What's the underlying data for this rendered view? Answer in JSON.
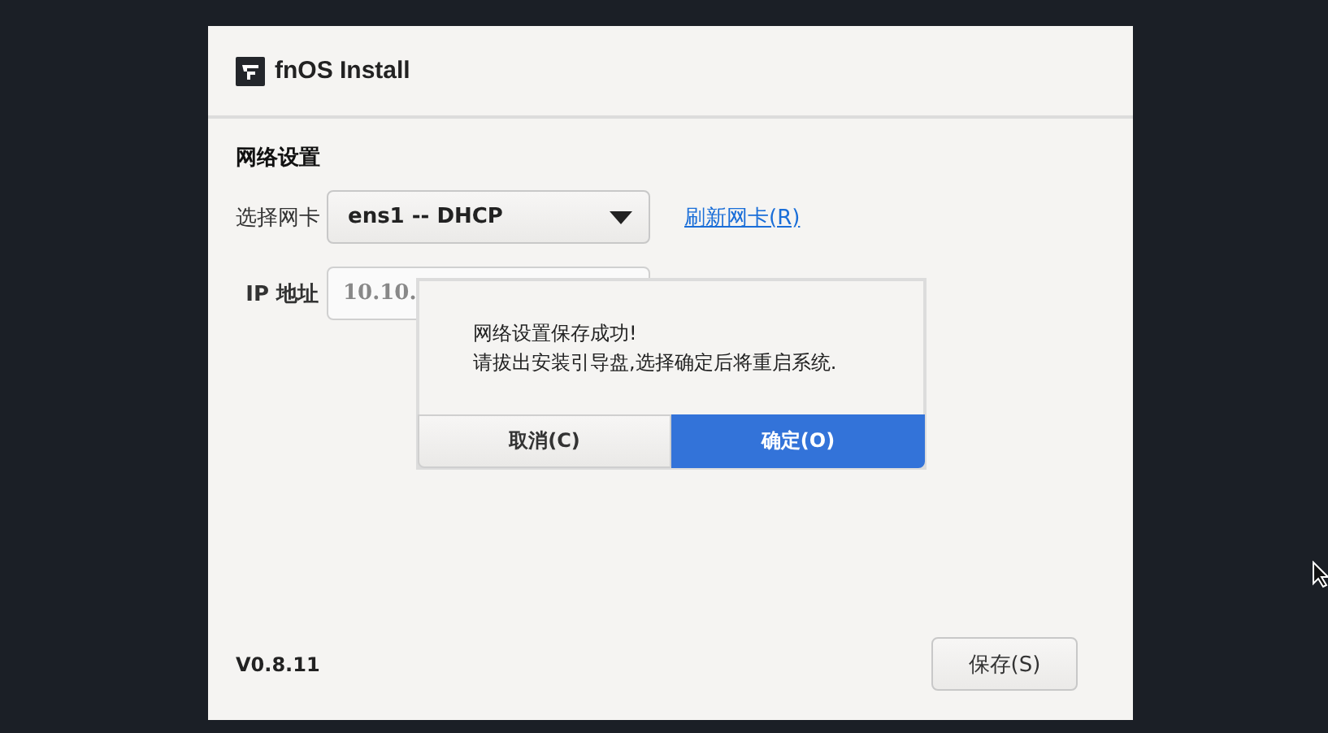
{
  "window": {
    "title": "fnOS Install"
  },
  "section_title": "网络设置",
  "nic": {
    "label": "选择网卡",
    "value": "ens1 -- DHCP",
    "refresh_link": "刷新网卡(R)"
  },
  "ip": {
    "label": "IP 地址",
    "value": "10.10."
  },
  "version": "V0.8.11",
  "save_button": "保存(S)",
  "dialog": {
    "lines": [
      "网络设置保存成功!",
      "请拔出安装引导盘,选择确定后将重启系统."
    ],
    "buttons": [
      {
        "label": "取消(C)",
        "selected": false
      },
      {
        "label": "确定(O)",
        "selected": true
      }
    ]
  }
}
